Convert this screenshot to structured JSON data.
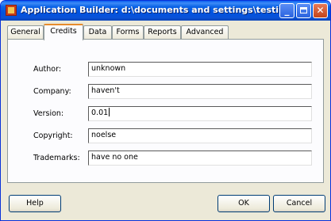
{
  "window": {
    "title": "Application Builder: d:\\documents and settings\\testing\\мои докумен...",
    "minimize_label": "_",
    "close_label": "✕"
  },
  "tabs": [
    {
      "label": "General"
    },
    {
      "label": "Credits"
    },
    {
      "label": "Data"
    },
    {
      "label": "Forms"
    },
    {
      "label": "Reports"
    },
    {
      "label": "Advanced"
    }
  ],
  "active_tab": "Credits",
  "fields": [
    {
      "label": "Author:",
      "value": "unknown"
    },
    {
      "label": "Company:",
      "value": "haven't"
    },
    {
      "label": "Version:",
      "value": "0.01"
    },
    {
      "label": "Copyright:",
      "value": "noelse"
    },
    {
      "label": "Trademarks:",
      "value": "have no one"
    }
  ],
  "buttons": {
    "help": "Help",
    "ok": "OK",
    "cancel": "Cancel"
  },
  "colors": {
    "titlebar": "#0054e3",
    "dialog_bg": "#ece9d8",
    "panel_bg": "#fcfcfe",
    "active_tab_accent": "#e68b2c"
  }
}
